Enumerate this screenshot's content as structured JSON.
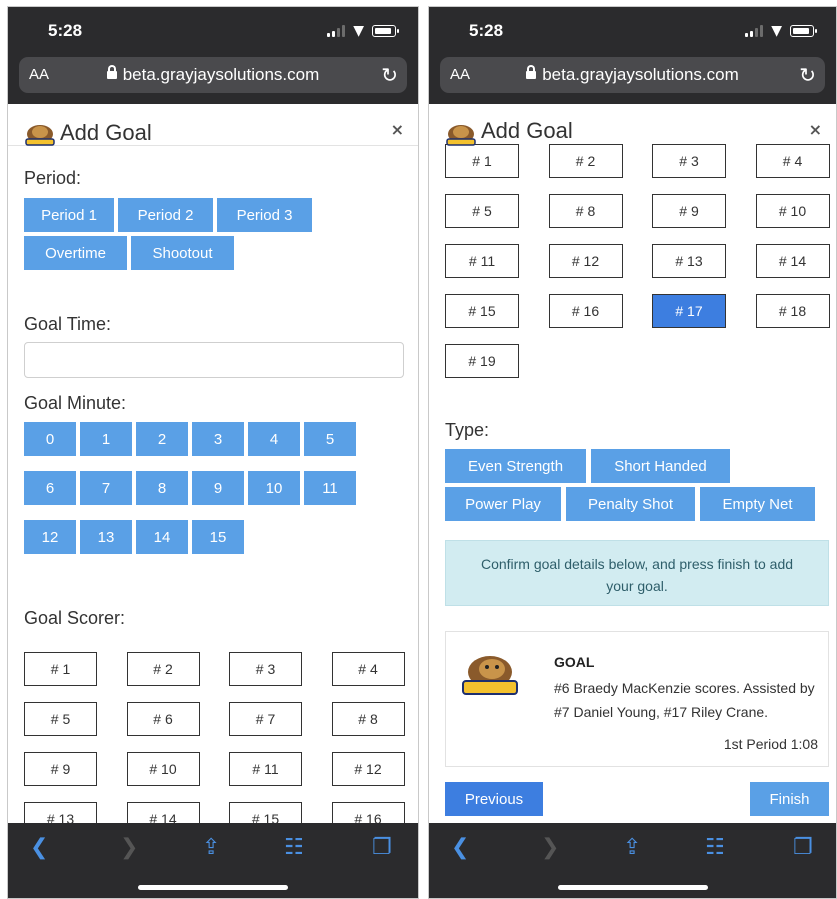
{
  "status": {
    "time": "5:28"
  },
  "browser": {
    "text_size": "AA",
    "url": "beta.grayjaysolutions.com"
  },
  "modal": {
    "title": "Add Goal",
    "close": "×"
  },
  "left": {
    "period_label": "Period:",
    "periods": [
      "Period 1",
      "Period 2",
      "Period 3",
      "Overtime",
      "Shootout"
    ],
    "goal_time_label": "Goal Time:",
    "goal_time_value": "",
    "goal_minute_label": "Goal Minute:",
    "minutes": [
      "0",
      "1",
      "2",
      "3",
      "4",
      "5",
      "6",
      "7",
      "8",
      "9",
      "10",
      "11",
      "12",
      "13",
      "14",
      "15"
    ],
    "scorer_label": "Goal Scorer:",
    "scorers": [
      "# 1",
      "# 2",
      "# 3",
      "# 4",
      "# 5",
      "# 6",
      "# 7",
      "# 8",
      "# 9",
      "# 10",
      "# 11",
      "# 12",
      "# 13",
      "# 14",
      "# 15",
      "# 16"
    ]
  },
  "right": {
    "players": [
      "# 1",
      "# 2",
      "# 3",
      "# 4",
      "# 5",
      "# 8",
      "# 9",
      "# 10",
      "# 11",
      "# 12",
      "# 13",
      "# 14",
      "# 15",
      "# 16",
      "# 17",
      "# 18",
      "# 19"
    ],
    "selected_player": "# 17",
    "type_label": "Type:",
    "types": [
      "Even Strength",
      "Short Handed",
      "Power Play",
      "Penalty Shot",
      "Empty Net"
    ],
    "alert": "Confirm goal details below, and press finish to add your goal.",
    "summary": {
      "title": "GOAL",
      "text": "#6 Braedy MacKenzie scores. Assisted by #7 Daniel Young, #17 Riley Crane.",
      "time": "1st Period 1:08"
    },
    "previous_label": "Previous",
    "finish_label": "Finish"
  },
  "colors": {
    "primary": "#5aa0e6",
    "primary_dark": "#3d7ee0",
    "chrome": "#2b2b2d",
    "alert_bg": "#d2ecf1"
  }
}
